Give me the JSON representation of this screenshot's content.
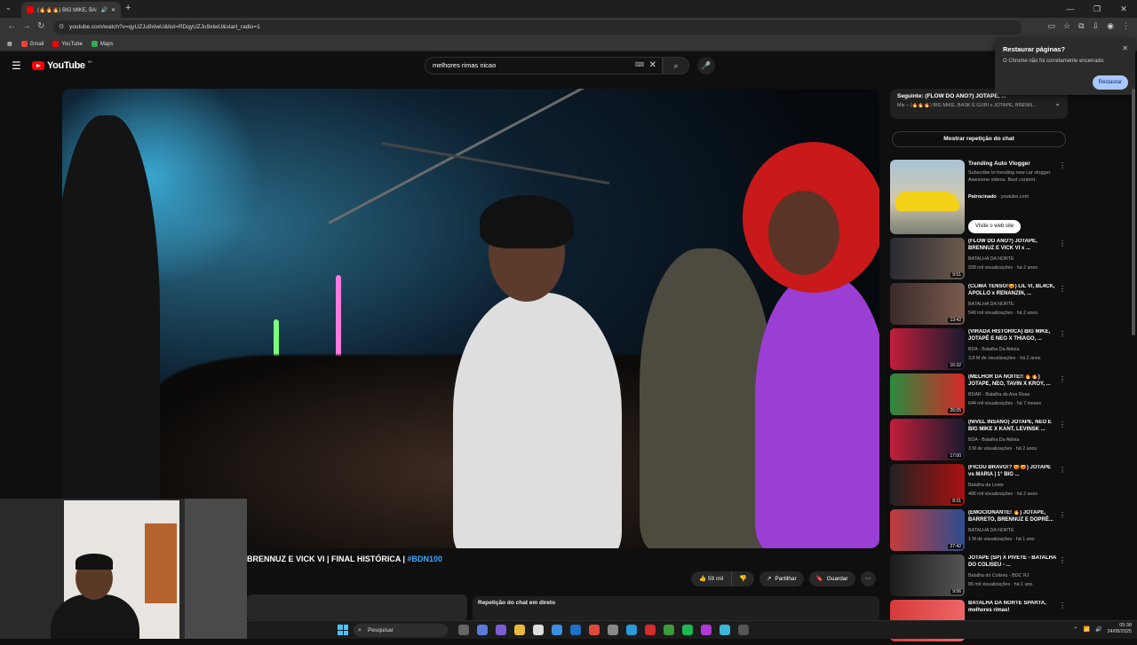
{
  "browser": {
    "tab_title": "(🔥🔥🔥) BIG MIKE, BASK",
    "url": "youtube.com/watch?v=qyUZJu9xlwU&list=RDqyUZJu9xlwU&start_radio=1",
    "bookmarks": [
      {
        "label": "Gmail",
        "color": "#ea4335"
      },
      {
        "label": "YouTube",
        "color": "#ff0000"
      },
      {
        "label": "Maps",
        "color": "#34a853"
      }
    ]
  },
  "restore_popup": {
    "title": "Restaurar páginas?",
    "message": "O Chrome não foi corretamente encerrado.",
    "button": "Restaurar"
  },
  "youtube": {
    "logo_text": "YouTube",
    "logo_region": "BR",
    "search_value": "melhores rimas nicao"
  },
  "video": {
    "title_prefix": "BRENNUZ E VICK VI | FINAL HISTÓRICA | ",
    "hashtag": "#BDN100",
    "likes": "59 mil",
    "share": "Partilhar",
    "save": "Guardar",
    "chat_replay_label": "Repetição do chat em direto"
  },
  "sidebar": {
    "mix_title": "Seguinte: (FLOW DO ANO?) JOTAPÊ, ...",
    "mix_subtitle": "Mix – (🔥🔥🔥) BIG MIKE, BASK E GURI x JOTAPÊ, BRENN...",
    "chat_button": "Mostrar repetição do chat",
    "ad": {
      "title": "Trending Auto Vlogger",
      "desc": "Subscribe to trending new car vlogger. Awesome videos. Best content.",
      "sponsored": "Patrocinado",
      "domain": "youtube.com",
      "cta": "Visite o web site"
    },
    "videos": [
      {
        "title": "(FLOW DO ANO?) JOTAPÊ, BRENNUZ E VICK VI x ...",
        "channel": "BATALHA DA NORTE",
        "meta": "928 mil visualizações · há 2 anos",
        "duration": "9:51",
        "c1": "#2a2a33",
        "c2": "#6b5a4a"
      },
      {
        "title": "(CLIMA TENSO!😡) LIL VI, BL4CK, APOLLO x RENANZIN, ...",
        "channel": "BATALHA DA NORTE",
        "meta": "540 mil visualizações · há 2 anos",
        "duration": "13:42",
        "c1": "#3a2a2a",
        "c2": "#7a5a4d"
      },
      {
        "title": "(VIRADA HISTÓRICA) BIG MIKE, JOTAPÊ E NEO X THIAGO, ...",
        "channel": "BDA - Batalha Da Aldeia",
        "meta": "3,8 M de visualizações · há 2 anos",
        "duration": "16:32",
        "c1": "#c21e3a",
        "c2": "#1a1a2e"
      },
      {
        "title": "(MELHOR DA NOITE!! 🔥🔥) JOTAPE, NEO, TAVIN X KROY, ...",
        "channel": "BDAR - Batalha do Ana Rosa",
        "meta": "644 mil visualizações · há 7 meses",
        "duration": "26:05",
        "c1": "#2b8a3e",
        "c2": "#d62828"
      },
      {
        "title": "(NÍVEL INSANO) JOTAPÊ, NEO E BIG MIKE X KANT, LEVINSK ...",
        "channel": "BDA - Batalha Da Aldeia",
        "meta": "3 M de visualizações · há 2 anos",
        "duration": "17:00",
        "c1": "#c21e3a",
        "c2": "#1a1a2e"
      },
      {
        "title": "(FICOU BRAVO!? 😡😡) JOTAPÊ vs MARIA | 1° BIG ...",
        "channel": "Batalha da Leste",
        "meta": "486 mil visualizações · há 2 anos",
        "duration": "8:31",
        "c1": "#222222",
        "c2": "#aa1111"
      },
      {
        "title": "(EMOCIONANTE! 🔥) JOTAPÊ, BARRETO, BRENNUZ E DOPRÊ...",
        "channel": "BATALHA DA NORTE",
        "meta": "1 M de visualizações · há 1 ano",
        "duration": "27:42",
        "c1": "#c43b3b",
        "c2": "#2d4d8f"
      },
      {
        "title": "JOTAPÊ (SP) X PIVETE - BATALHA DO COLISEU - ...",
        "channel": "Batalha do Coliseu - BDC RJ",
        "meta": "86 mil visualizações · há 1 ano",
        "duration": "9:56",
        "c1": "#1b1b1b",
        "c2": "#555555"
      },
      {
        "title": "BATALHA DA NORTE SPARTA, melhores rimas!",
        "channel": "",
        "meta": "",
        "duration": "",
        "c1": "#d63a3a",
        "c2": "#ee6666"
      }
    ]
  },
  "taskbar": {
    "search_label": "Pesquisar",
    "time": "05:38",
    "date": "24/08/2025"
  }
}
